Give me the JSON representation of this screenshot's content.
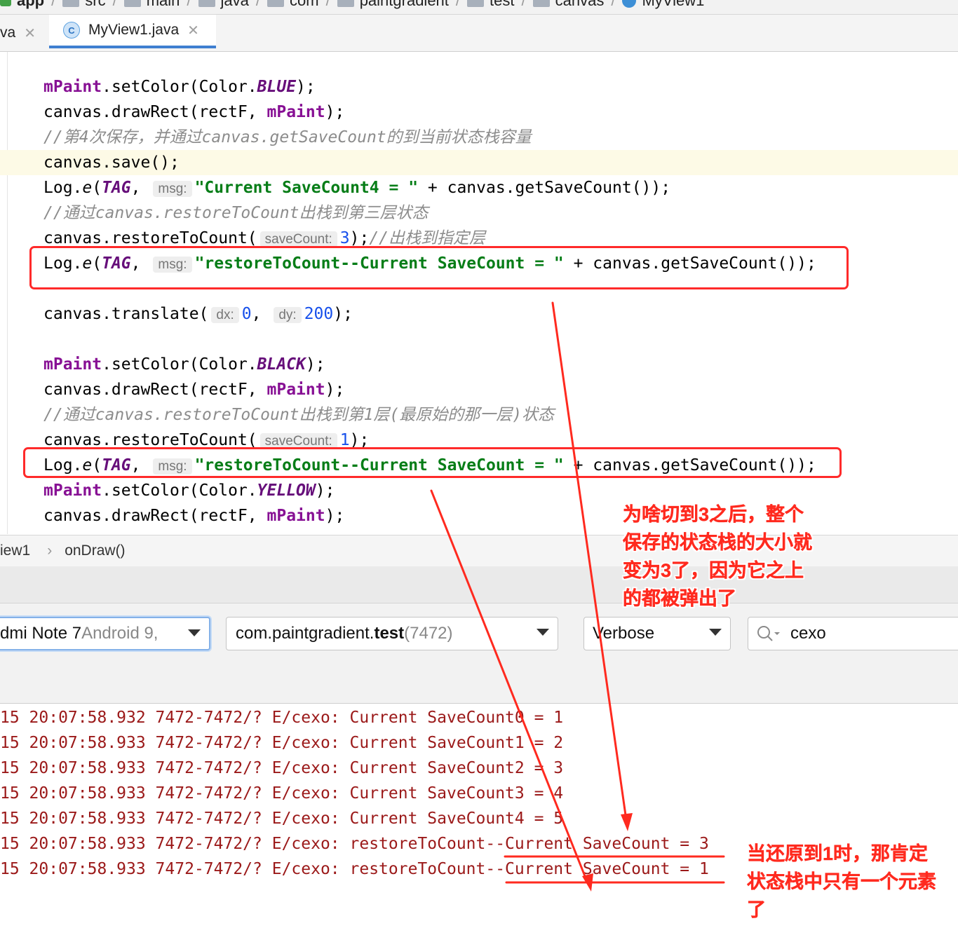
{
  "breadcrumb": [
    "app",
    "src",
    "main",
    "java",
    "com",
    "paintgradient",
    "test",
    "canvas",
    "MyView1"
  ],
  "tabs": [
    {
      "label": "va",
      "active": false
    },
    {
      "label": "MyView1.java",
      "active": true,
      "icon": "C"
    }
  ],
  "code": {
    "line1": {
      "f": "mPaint",
      "a": ".setColor(Color.",
      "c": "BLUE",
      "b": ");"
    },
    "line2": {
      "a": "canvas.drawRect(rectF, ",
      "f": "mPaint",
      "b": ");"
    },
    "line3": {
      "pre": "//第4次保存，并通过",
      "code": "canvas.getSaveCount",
      "post": "的到当前状态栈容量"
    },
    "line4": "canvas.save();",
    "line5": {
      "a": "Log.",
      "e": "e",
      "p": "(",
      "tag": "TAG",
      "comma": ",",
      "hint": "msg:",
      "str": "\"Current SaveCount4 = \"",
      "rest": " + canvas.getSaveCount());"
    },
    "line6": {
      "pre": "//通过",
      "code": "canvas.restoreToCount",
      "post": "出栈到第三层状态"
    },
    "line7": {
      "a": "canvas.restoreToCount(",
      "hint": "saveCount:",
      "num": "3",
      "b": ");",
      "comment": "//出栈到指定层"
    },
    "line8": {
      "a": "Log.",
      "e": "e",
      "p": "(",
      "tag": "TAG",
      "comma": ",",
      "hint": "msg:",
      "str": "\"restoreToCount--Current SaveCount = \"",
      "rest": " + canvas.getSaveCount());"
    },
    "line9": {
      "a": "canvas.translate(",
      "hint1": "dx:",
      "num1": "0",
      "mid": ",",
      "hint2": "dy:",
      "num2": "200",
      "b": ");"
    },
    "line10": {
      "f": "mPaint",
      "a": ".setColor(Color.",
      "c": "BLACK",
      "b": ");"
    },
    "line11": {
      "a": "canvas.drawRect(rectF, ",
      "f": "mPaint",
      "b": ");"
    },
    "line12": {
      "pre": "//通过",
      "code": "canvas.restoreToCount",
      "post": "出栈到第1层(最原始的那一层)状态"
    },
    "line13": {
      "a": "canvas.restoreToCount(",
      "hint": "saveCount:",
      "num": "1",
      "b": ");"
    },
    "line14": {
      "a": "Log.",
      "e": "e",
      "p": "(",
      "tag": "TAG",
      "comma": ",",
      "hint": "msg:",
      "str": "\"restoreToCount--Current SaveCount = \"",
      "rest": " + canvas.getSaveCount());"
    },
    "line15": {
      "f": "mPaint",
      "a": ".setColor(Color.",
      "c": "YELLOW",
      "b": ");"
    },
    "line16": {
      "a": "canvas.drawRect(rectF, ",
      "f": "mPaint",
      "b": ");"
    }
  },
  "structure": {
    "cls": "iew1",
    "sep": "›",
    "method": "onDraw()"
  },
  "logcat": {
    "device": {
      "name": "dmi Note 7",
      "detail": " Android 9,"
    },
    "process": {
      "pkg": "com.paintgradient.",
      "bold": "test",
      "pid": " (7472)"
    },
    "level": "Verbose",
    "search": "cexo",
    "lines": [
      "15 20:07:58.932 7472-7472/? E/cexo: Current SaveCount0 = 1",
      "15 20:07:58.933 7472-7472/? E/cexo: Current SaveCount1 = 2",
      "15 20:07:58.933 7472-7472/? E/cexo: Current SaveCount2 = 3",
      "15 20:07:58.933 7472-7472/? E/cexo: Current SaveCount3 = 4",
      "15 20:07:58.933 7472-7472/? E/cexo: Current SaveCount4 = 5",
      "15 20:07:58.933 7472-7472/? E/cexo: restoreToCount--Current SaveCount = 3",
      "15 20:07:58.933 7472-7472/? E/cexo: restoreToCount--Current SaveCount = 1"
    ]
  },
  "annotations": {
    "a1": [
      "为啥切到3之后，整个",
      "保存的状态栈的大小就",
      "变为3了，因为它之上",
      "的都被弹出了"
    ],
    "a2": [
      "当还原到1时，那肯定",
      "状态栈中只有一个元素",
      "了"
    ]
  },
  "colors": {
    "annotation": "#ff2a1f",
    "tab_accent": "#3f7fd0",
    "log_text": "#9b1919"
  }
}
